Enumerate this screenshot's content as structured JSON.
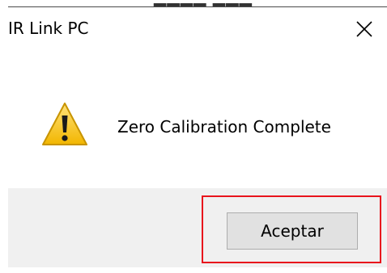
{
  "window": {
    "title": "IR Link PC",
    "close_icon": "close-icon"
  },
  "message": {
    "icon": "warning-icon",
    "text": "Zero Calibration Complete"
  },
  "actions": {
    "ok_label": "Aceptar"
  },
  "colors": {
    "highlight": "#e8141c",
    "footer_bg": "#f0f0f0",
    "button_bg": "#e1e1e1",
    "warning_yellow": "#f5c400"
  }
}
